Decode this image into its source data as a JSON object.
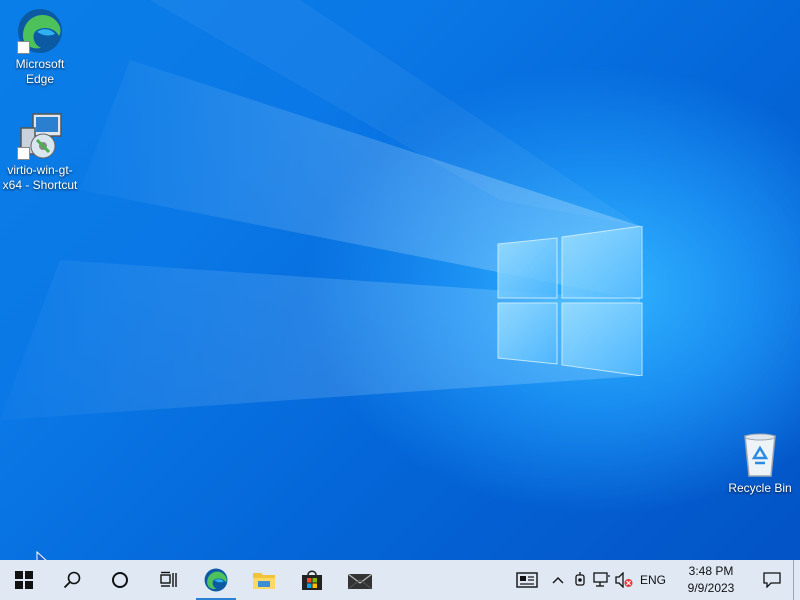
{
  "desktop": {
    "icons": [
      {
        "label_line1": "Microsoft",
        "label_line2": "Edge",
        "icon": "edge-icon"
      },
      {
        "label_line1": "virtio-win-gt-",
        "label_line2": "x64 - Shortcut",
        "icon": "installer-icon"
      },
      {
        "label_line1": "Recycle Bin",
        "icon": "recycle-bin-icon"
      }
    ]
  },
  "taskbar": {
    "pinned": [
      {
        "icon": "start-icon"
      },
      {
        "icon": "search-icon"
      },
      {
        "icon": "cortana-icon"
      },
      {
        "icon": "task-view-icon"
      },
      {
        "icon": "edge-icon",
        "active": true
      },
      {
        "icon": "file-explorer-icon"
      },
      {
        "icon": "store-icon"
      },
      {
        "icon": "mail-icon"
      }
    ],
    "tray": {
      "language": "ENG",
      "time": "3:48 PM",
      "date": "9/9/2023"
    }
  },
  "colors": {
    "desktop_blue": "#0a78e6",
    "taskbar_bg": "#dfe8f3",
    "edge_blue": "#0c59a4",
    "edge_green": "#4dc25a"
  }
}
